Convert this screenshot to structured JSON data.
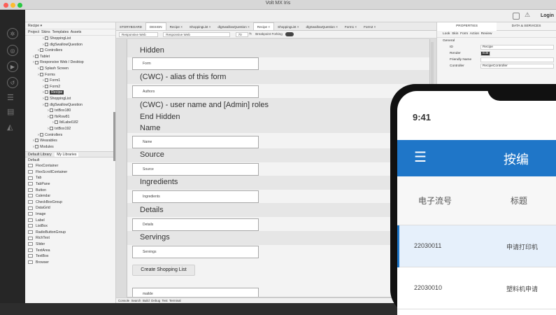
{
  "window": {
    "title": "Volt MX Iris"
  },
  "toolbar": {
    "login_label": "Login"
  },
  "left_panel": {
    "header": "Recipe ▾",
    "tabs": [
      "Project",
      "Skins",
      "Templates",
      "Assets"
    ],
    "tree": [
      {
        "label": "ShoppingList",
        "depth": 3,
        "icon": "form"
      },
      {
        "label": "dlgSwallowQuestion",
        "depth": 3,
        "icon": "form"
      },
      {
        "label": "Controllers",
        "depth": 2,
        "icon": "folder"
      },
      {
        "label": "Tablet",
        "depth": 1,
        "icon": "tablet"
      },
      {
        "label": "Responsive Web / Desktop",
        "depth": 1,
        "icon": "monitor"
      },
      {
        "label": "Splash Screen",
        "depth": 2,
        "icon": "splash"
      },
      {
        "label": "Forms",
        "depth": 2,
        "icon": "forms"
      },
      {
        "label": "Form1",
        "depth": 3,
        "icon": "form"
      },
      {
        "label": "Form2",
        "depth": 3,
        "icon": "form"
      },
      {
        "label": "Recipe",
        "depth": 3,
        "icon": "form",
        "selected": true
      },
      {
        "label": "ShoppingList",
        "depth": 3,
        "icon": "form"
      },
      {
        "label": "dlgSwallowQuestion",
        "depth": 3,
        "icon": "form"
      },
      {
        "label": "txtBox180",
        "depth": 4,
        "icon": "textbox"
      },
      {
        "label": "flxRow81",
        "depth": 4,
        "icon": "flex"
      },
      {
        "label": "lblLabel182",
        "depth": 5,
        "icon": "label"
      },
      {
        "label": "txtBox192",
        "depth": 4,
        "icon": "textbox"
      },
      {
        "label": "Controllers",
        "depth": 2,
        "icon": "folder"
      },
      {
        "label": "Wearables",
        "depth": 1,
        "icon": "wearable"
      },
      {
        "label": "Modules",
        "depth": 1,
        "icon": "module"
      }
    ],
    "library_tabs": [
      "Default Library",
      "My Libraries"
    ],
    "library_group": "Default",
    "library_items": [
      "FlexContainer",
      "FlexScrollContainer",
      "Tab",
      "TabPane",
      "Button",
      "Calendar",
      "CheckBoxGroup",
      "DataGrid",
      "Image",
      "Label",
      "ListBox",
      "RadioButtonGroup",
      "RichText",
      "Slider",
      "TextArea",
      "TextBox",
      "Browser"
    ]
  },
  "editor": {
    "tabs": [
      {
        "label": "STORYBOARD"
      },
      {
        "label": "DESIGN",
        "active": true
      },
      {
        "label": "Recipe ×"
      },
      {
        "label": "ShoppingList ×"
      },
      {
        "label": "dlgSwallowQuestion ×"
      },
      {
        "label": "Recipe ×",
        "active": true
      },
      {
        "label": "ShoppingList ×"
      },
      {
        "label": "dlgSwallowQuestion ×"
      },
      {
        "label": "Form1 ×"
      },
      {
        "label": "Form2 ×"
      }
    ],
    "subbar": {
      "device1": "Responsive Web",
      "device2": "Responsive Web",
      "zoom": "70",
      "zoom_unit": "%",
      "breakpoint_label": "Breakpoint Forking"
    },
    "form": {
      "hidden_label": "Hidden",
      "form_input": "Form",
      "cwc_alias": "(CWC) - alias of this form",
      "authors_input": "Authors",
      "cwc_roles": "(CWC) - user name and [Admin] roles",
      "end_hidden": "End Hidden",
      "name_label": "Name",
      "name_input": "Name",
      "source_label": "Source",
      "source_input": "Source",
      "ingredients_label": "Ingredients",
      "ingredients_input": "Ingredients",
      "details_label": "Details",
      "details_input": "Details",
      "servings_label": "Servings",
      "servings_input": "Servings",
      "shopping_button": "Create Shopping List",
      "last_input": "mailde"
    },
    "bottom_tabs": [
      "Console",
      "Search",
      "Build",
      "Debug",
      "Test",
      "Terminal"
    ]
  },
  "properties": {
    "tabs": [
      "PROPERTIES",
      "DATA & SERVICES"
    ],
    "subtabs": [
      "Look",
      "Skin",
      "Form",
      "Action",
      "Review"
    ],
    "section": "General",
    "rows": [
      {
        "label": "ID",
        "value": "Recipe"
      },
      {
        "label": "Render",
        "value": "Edit"
      },
      {
        "label": "Friendly Name",
        "value": ""
      },
      {
        "label": "Controller",
        "value": "RecipeController"
      }
    ]
  },
  "phone": {
    "time": "9:41",
    "header_title": "按编",
    "columns": [
      "电子流号",
      "标题"
    ],
    "rows": [
      {
        "id": "22030011",
        "title": "申请打印机"
      },
      {
        "id": "22030010",
        "title": "塑料机申请"
      }
    ],
    "accent": "#1f76c8"
  }
}
